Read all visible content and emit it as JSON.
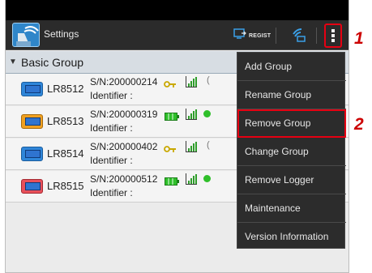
{
  "app": {
    "title": "Settings",
    "icon": "app-settings-icon"
  },
  "toolbar": {
    "regist_label": "REGIST",
    "regist_icon": "regist-icon",
    "signal_icon": "wireless-signal-icon",
    "overflow_icon": "overflow-menu-icon"
  },
  "group": {
    "name": "Basic Group",
    "arrow": "▼"
  },
  "loggers": [
    {
      "model": "LR8512",
      "serial": "S/N:200000214",
      "identifier": "Identifier :",
      "frame_color": "#2f86d9",
      "status_icon": "key-icon",
      "has_green_dot": false
    },
    {
      "model": "LR8513",
      "serial": "S/N:200000319",
      "identifier": "Identifier :",
      "frame_color": "#f0a020",
      "status_icon": "battery-icon",
      "has_green_dot": true
    },
    {
      "model": "LR8514",
      "serial": "S/N:200000402",
      "identifier": "Identifier :",
      "frame_color": "#2f86d9",
      "status_icon": "key-icon",
      "has_green_dot": false
    },
    {
      "model": "LR8515",
      "serial": "S/N:200000512",
      "identifier": "Identifier :",
      "frame_color": "#e8505a",
      "status_icon": "battery-icon",
      "has_green_dot": true
    }
  ],
  "menu": {
    "items": [
      "Add Group",
      "Rename Group",
      "Remove Group",
      "Change Group",
      "Remove Logger",
      "Maintenance",
      "Version Information"
    ],
    "highlighted": "Remove Group"
  },
  "callouts": [
    "1",
    "2"
  ],
  "colors": {
    "accent_red": "#e60012",
    "callout_red": "#cc0000",
    "menu_bg": "#2c2c2c",
    "action_bar": "#2b2b2b"
  }
}
